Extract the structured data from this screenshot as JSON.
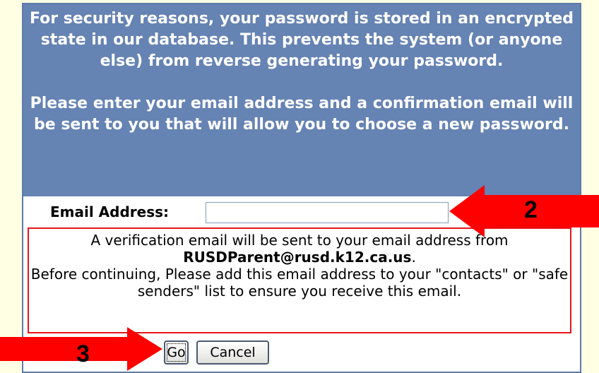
{
  "info": {
    "paragraph1": "For security reasons, your password is stored in an encrypted state in our database. This prevents the system (or anyone else) from reverse generating your password.",
    "paragraph2": "Please enter your email address and a confirmation email will be sent to you that will allow you to choose a new password."
  },
  "form": {
    "email_label": "Email Address:",
    "email_value": "",
    "email_placeholder": ""
  },
  "notice": {
    "line1": "A verification email will be sent to your email address from",
    "sender": "RUSDParent@rusd.k12.ca.us",
    "sender_suffix": ".",
    "line2": "Before continuing, Please add this email address to your \"contacts\" or \"safe senders\" list to ensure you receive this email."
  },
  "buttons": {
    "go_label": "Go",
    "cancel_label": "Cancel"
  },
  "annotations": {
    "step2": "2",
    "step3": "3",
    "arrow_color": "#ff0000"
  },
  "colors": {
    "page_background": "#ffffe3",
    "info_background": "#6583b3",
    "notice_border": "#e8141a"
  }
}
